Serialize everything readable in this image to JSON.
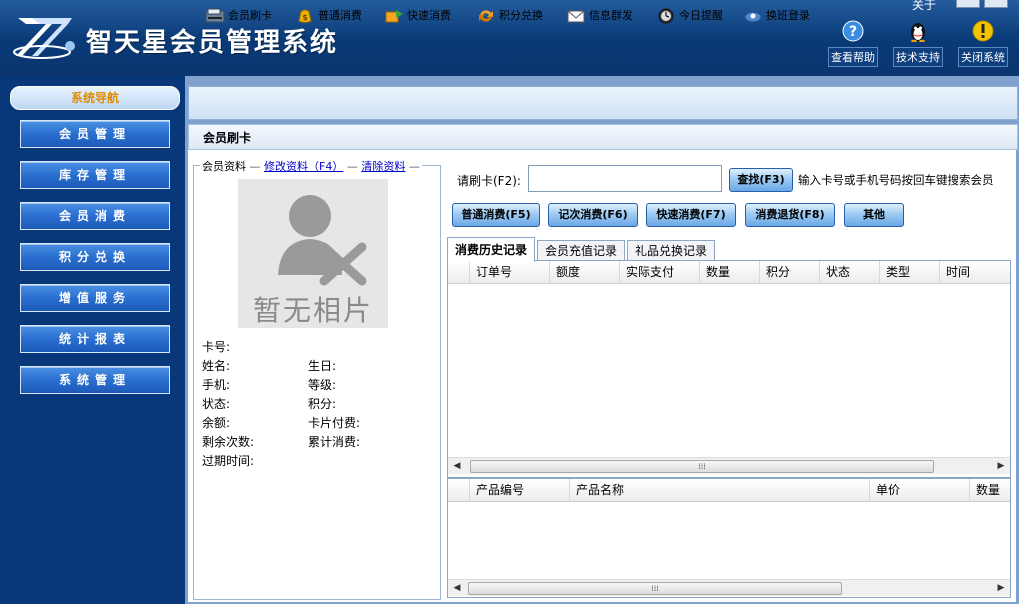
{
  "app": {
    "title": "智天星会员管理系统",
    "about_label": "关于"
  },
  "header_buttons": [
    {
      "label": "查看帮助",
      "icon": "help-icon"
    },
    {
      "label": "技术支持",
      "icon": "qq-penguin-icon"
    },
    {
      "label": "关闭系统",
      "icon": "warning-icon"
    }
  ],
  "sidebar": {
    "title": "系统导航",
    "items": [
      {
        "label": "会员管理"
      },
      {
        "label": "库存管理"
      },
      {
        "label": "会员消费"
      },
      {
        "label": "积分兑换"
      },
      {
        "label": "增值服务"
      },
      {
        "label": "统计报表"
      },
      {
        "label": "系统管理"
      }
    ]
  },
  "toolbar": {
    "items": [
      {
        "label": "会员刷卡",
        "icon": "card-reader-icon"
      },
      {
        "label": "普通消费",
        "icon": "money-bag-icon"
      },
      {
        "label": "快速消费",
        "icon": "fast-spend-icon"
      },
      {
        "label": "积分兑换",
        "icon": "exchange-icon"
      },
      {
        "label": "信息群发",
        "icon": "mail-icon"
      },
      {
        "label": "今日提醒",
        "icon": "clock-icon"
      },
      {
        "label": "换班登录",
        "icon": "shift-login-icon"
      }
    ]
  },
  "page": {
    "section_title": "会员刷卡"
  },
  "member": {
    "legend": "会员资料",
    "edit_link": "修改资料（F4）",
    "clear_link": "清除资料",
    "photo_placeholder": "暂无相片",
    "fields_left": [
      "卡号:",
      "姓名:",
      "手机:",
      "状态:",
      "余额:",
      "剩余次数:",
      "过期时间:"
    ],
    "fields_right": [
      "生日:",
      "等级:",
      "积分:",
      "卡片付费:",
      "累计消费:"
    ]
  },
  "search": {
    "label": "请刷卡(F2):",
    "value": "",
    "find_button": "查找(F3)",
    "hint": "输入卡号或手机号码按回车键搜索会员"
  },
  "actions": [
    {
      "label": "普通消费(F5)"
    },
    {
      "label": "记次消费(F6)"
    },
    {
      "label": "快速消费(F7)"
    },
    {
      "label": "消费退货(F8)"
    },
    {
      "label": "其他"
    }
  ],
  "tabs": [
    {
      "label": "消费历史记录",
      "active": true
    },
    {
      "label": "会员充值记录",
      "active": false
    },
    {
      "label": "礼品兑换记录",
      "active": false
    }
  ],
  "history_table": {
    "columns": [
      "订单号",
      "额度",
      "实际支付",
      "数量",
      "积分",
      "状态",
      "类型",
      "时间"
    ],
    "rows": []
  },
  "product_table": {
    "columns": [
      "产品编号",
      "产品名称",
      "单价",
      "数量"
    ],
    "rows": []
  },
  "colors": {
    "header_bg": "#0c4a92",
    "sidebar_bg": "#08377a",
    "nav_button": "#2a6fd0",
    "nav_title_text": "#e08c00",
    "link": "#0000cc"
  }
}
